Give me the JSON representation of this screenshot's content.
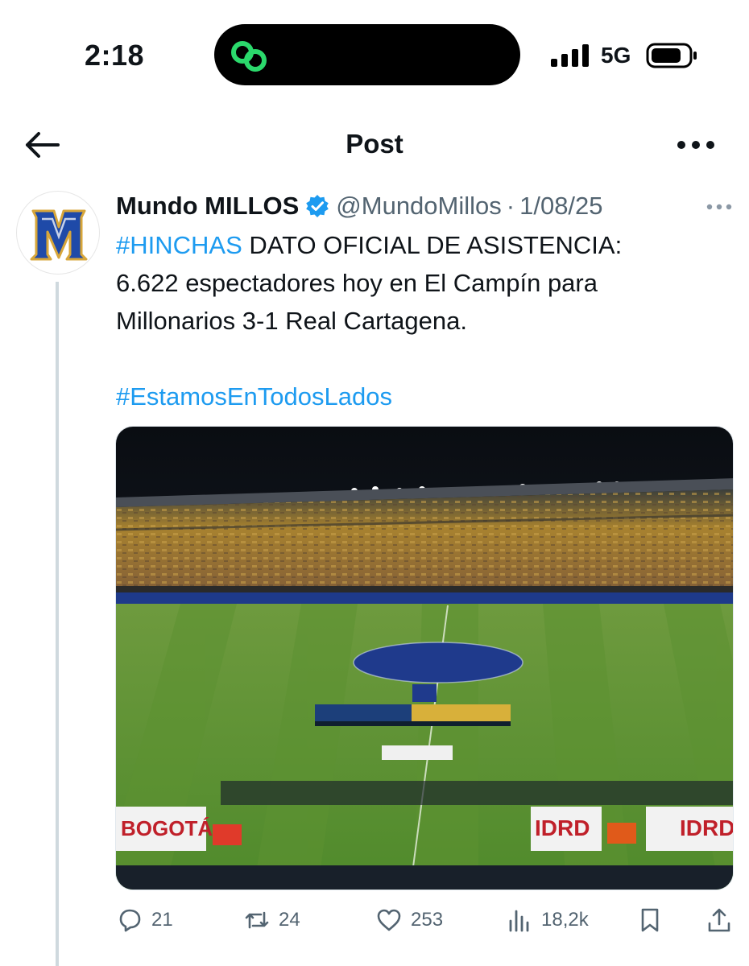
{
  "status_bar": {
    "time": "2:18",
    "network": "5G"
  },
  "header": {
    "title": "Post"
  },
  "tweet": {
    "author_name": "Mundo MILLOS",
    "handle": "@MundoMillos",
    "separator": "·",
    "date": "1/08/25",
    "text": {
      "hashtag1": "#HINCHAS",
      "line1_rest": " DATO OFICIAL DE ASISTENCIA:",
      "line2": "6.622 espectadores hoy en El Campín para",
      "line3": "Millonarios 3-1 Real Cartagena.",
      "hashtag2": "#EstamosEnTodosLados"
    },
    "media": {
      "banners": [
        "BOGOTÁ",
        "IDRD",
        "IDRD"
      ]
    }
  },
  "actions": {
    "replies": "21",
    "reposts": "24",
    "likes": "253",
    "views": "18,2k"
  },
  "colors": {
    "accent": "#1d9bf0",
    "muted": "#536471",
    "island_icon": "#2bd96c"
  },
  "icons": [
    "back-arrow-icon",
    "more-icon",
    "verified-badge-icon",
    "reply-icon",
    "repost-icon",
    "like-icon",
    "views-icon",
    "bookmark-icon",
    "share-icon"
  ]
}
